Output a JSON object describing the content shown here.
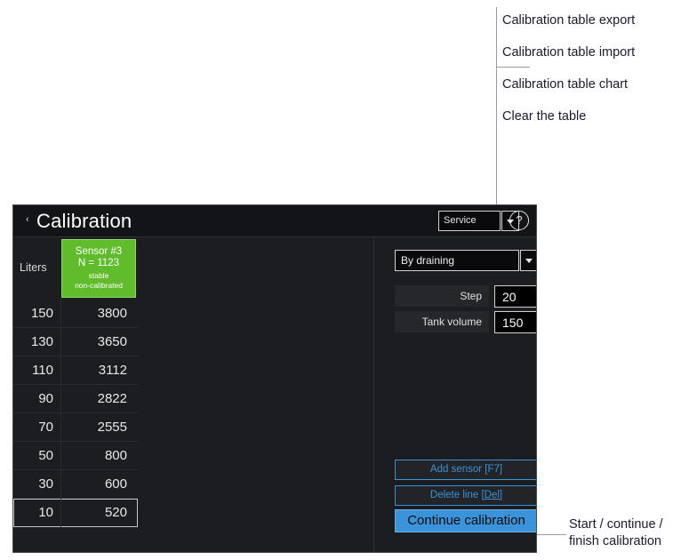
{
  "callouts": [
    {
      "id": "export",
      "text": "Calibration table export"
    },
    {
      "id": "import",
      "text": "Calibration table import"
    },
    {
      "id": "chart",
      "text": "Calibration table chart"
    },
    {
      "id": "clear",
      "text": "Clear the table"
    }
  ],
  "callout_button": {
    "line1": "Start / continue /",
    "line2": "finish calibration"
  },
  "panel": {
    "titlebar": {
      "back_icon": "‹",
      "title": "Calibration",
      "mode_select": {
        "value": "Service",
        "arrow_icon": "chevron-down-icon"
      },
      "help_icon": "?"
    },
    "table": {
      "header": {
        "liters_label": "Liters",
        "sensor": {
          "name": "Sensor #3",
          "reading": "N = 1123",
          "stability": "stable",
          "calibration": "non-calibrated"
        }
      },
      "rows": [
        {
          "liters": "150",
          "value": "3800",
          "selected": false
        },
        {
          "liters": "130",
          "value": "3650",
          "selected": false
        },
        {
          "liters": "110",
          "value": "3112",
          "selected": false
        },
        {
          "liters": "90",
          "value": "2822",
          "selected": false
        },
        {
          "liters": "70",
          "value": "2555",
          "selected": false
        },
        {
          "liters": "50",
          "value": "800",
          "selected": false
        },
        {
          "liters": "30",
          "value": "600",
          "selected": false
        },
        {
          "liters": "10",
          "value": "520",
          "selected": true
        }
      ]
    },
    "controls": {
      "method_select": {
        "value": "By draining",
        "arrow_icon": "chevron-down-icon"
      },
      "step": {
        "label": "Step",
        "value": "20"
      },
      "tank_volume": {
        "label": "Tank volume",
        "value": "150"
      },
      "buttons": {
        "add_sensor": "Add sensor [F7]",
        "delete_line_prefix": "Delete line ",
        "delete_line_key": "[Del]",
        "continue": "Continue calibration"
      }
    }
  },
  "colors": {
    "panel_bg": "#1c1d21",
    "titlebar_bg": "#131417",
    "accent_blue": "#3b93d9",
    "sensor_green": "#61bc2b",
    "leader_gray": "#9a9a9a"
  }
}
